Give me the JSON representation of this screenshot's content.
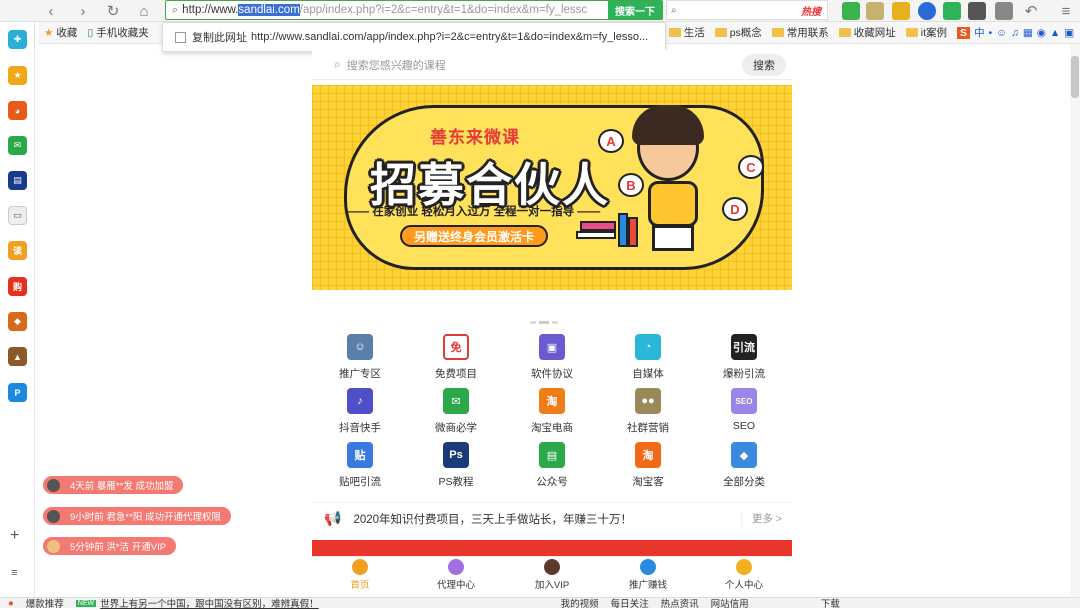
{
  "browser": {
    "url_prefix": "http://www.",
    "url_highlight": "sandlai.com",
    "url_rest": "/app/index.php?i=2&c=entry&t=1&do=index&m=fy_lessc",
    "url_search_btn": "搜索一下",
    "search2_placeholder": "",
    "hot_label": "热搜",
    "dropdown_label": "复制此网址",
    "dropdown_url": "http://www.sandlai.com/app/index.php?i=2&c=entry&t=1&do=index&m=fy_lesso..."
  },
  "bookmarks": [
    {
      "label": "收藏"
    },
    {
      "label": "手机收藏夹"
    },
    {
      "label": "生活"
    },
    {
      "label": "ps概念"
    },
    {
      "label": "常用联系"
    },
    {
      "label": "收藏网址"
    },
    {
      "label": "it案例"
    }
  ],
  "search": {
    "placeholder": "搜索您感兴趣的课程",
    "button": "搜索"
  },
  "banner": {
    "brand": "善东来微课",
    "headline": "招募合伙人",
    "subline": "—— 在家创业 轻松月入过万 全程一对一指导 ——",
    "pill": "另赠送终身会员激活卡",
    "bubbles": [
      "A",
      "B",
      "C",
      "D"
    ]
  },
  "grid": [
    {
      "label": "推广专区",
      "color": "#5a7fa8",
      "glyph": "☺"
    },
    {
      "label": "免费项目",
      "color": "#ffffff",
      "glyph": "免"
    },
    {
      "label": "软件协议",
      "color": "#6a5bcf",
      "glyph": "▣"
    },
    {
      "label": "自媒体",
      "color": "#2bb8d8",
      "glyph": "◔"
    },
    {
      "label": "爆粉引流",
      "color": "#222222",
      "glyph": "引流"
    },
    {
      "label": "抖音快手",
      "color": "#4f4fc8",
      "glyph": "♪"
    },
    {
      "label": "微商必学",
      "color": "#2aa84a",
      "glyph": "✉"
    },
    {
      "label": "淘宝电商",
      "color": "#f07c18",
      "glyph": "淘"
    },
    {
      "label": "社群营销",
      "color": "#9a8a5a",
      "glyph": "●●"
    },
    {
      "label": "SEO",
      "color": "#9a86e8",
      "glyph": "SEO"
    },
    {
      "label": "贴吧引流",
      "color": "#3a7ae0",
      "glyph": "贴"
    },
    {
      "label": "PS教程",
      "color": "#1a3a7a",
      "glyph": "Ps"
    },
    {
      "label": "公众号",
      "color": "#2aa84a",
      "glyph": "▤"
    },
    {
      "label": "淘宝客",
      "color": "#f06a18",
      "glyph": "淘"
    },
    {
      "label": "全部分类",
      "color": "#3a8ae0",
      "glyph": "◆"
    }
  ],
  "notice": {
    "text": "2020年知识付费项目，三天上手做站长，年赚三十万！",
    "more": "更多 >"
  },
  "bottomnav": [
    {
      "label": "首页",
      "active": true,
      "color": "#f0a020"
    },
    {
      "label": "代理中心",
      "active": false,
      "color": "#a070e0"
    },
    {
      "label": "加入VIP",
      "active": false,
      "color": "#5a3a2a"
    },
    {
      "label": "推广赚钱",
      "active": false,
      "color": "#2a8ae0"
    },
    {
      "label": "个人中心",
      "active": false,
      "color": "#f0b020"
    }
  ],
  "toasts": [
    {
      "text": "4天前 暴雁**发 成功加盟"
    },
    {
      "text": "9小时前 君急**阳 成功开通代理权限"
    },
    {
      "text": "5分钟前 洪*洁 开通VIP"
    }
  ],
  "statusbar": {
    "left": "爆款推荐",
    "news": "世界上有另一个中国，跟中国没有区别，难辨真假！",
    "new_badge": "NEW",
    "video": "我的视频",
    "daily": "每日关注",
    "hotnews": "热点资讯",
    "credit": "网站信用",
    "download": "下载"
  }
}
